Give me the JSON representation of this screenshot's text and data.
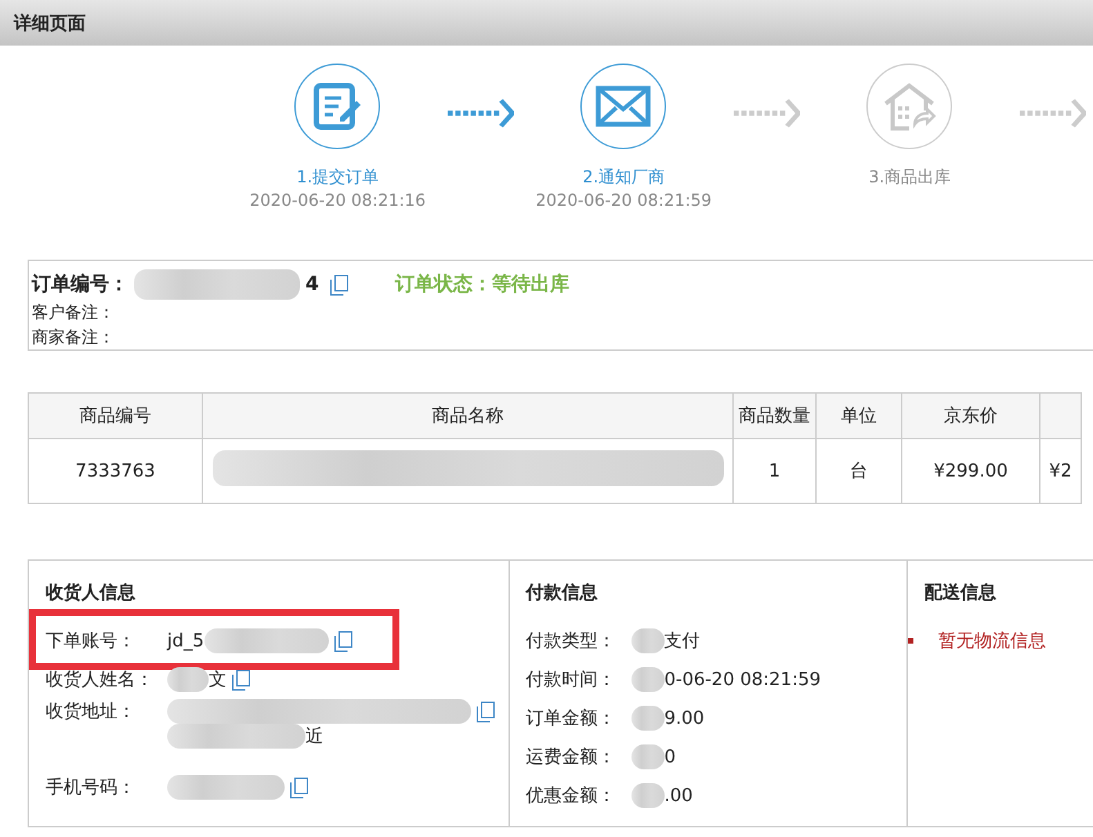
{
  "window": {
    "title": "详细页面"
  },
  "steps": [
    {
      "label": "1.提交订单",
      "time": "2020-06-20 08:21:16",
      "done": true
    },
    {
      "label": "2.通知厂商",
      "time": "2020-06-20 08:21:59",
      "done": true
    },
    {
      "label": "3.商品出库",
      "done": false
    }
  ],
  "trailing_arrow": {
    "done": false
  },
  "order": {
    "number_label": "订单编号：",
    "number_tail": "4",
    "status": "订单状态：等待出库",
    "notes": [
      "客户备注：",
      "商家备注："
    ]
  },
  "table": {
    "columns": [
      "商品编号",
      "商品名称",
      "商品数量",
      "单位",
      "京东价"
    ],
    "rows": [
      {
        "cells": [
          "7333763",
          "",
          "1",
          "台",
          "¥299.00",
          "¥2"
        ]
      }
    ]
  },
  "consignee": {
    "title": "收货人信息",
    "rows": [
      {
        "kind": "account",
        "label": "下单账号：",
        "value": "jd_5",
        "highlighted": true
      },
      {
        "kind": "text",
        "label": "收货人姓名：",
        "value": "文"
      },
      {
        "kind": "address",
        "label": "收货地址：",
        "value": "近"
      },
      {
        "kind": "phone",
        "label": "手机号码："
      }
    ]
  },
  "payment": {
    "title": "付款信息",
    "rows": [
      {
        "label": "付款类型：",
        "value": "支付"
      },
      {
        "label": "付款时间：",
        "value": "0-06-20 08:21:59"
      },
      {
        "label": "订单金额：",
        "value": "9.00"
      },
      {
        "label": "运费金额：",
        "value": "0"
      },
      {
        "label": "优惠金额：",
        "value": ".00"
      }
    ]
  },
  "delivery": {
    "title": "配送信息",
    "items": [
      "暂无物流信息"
    ]
  }
}
